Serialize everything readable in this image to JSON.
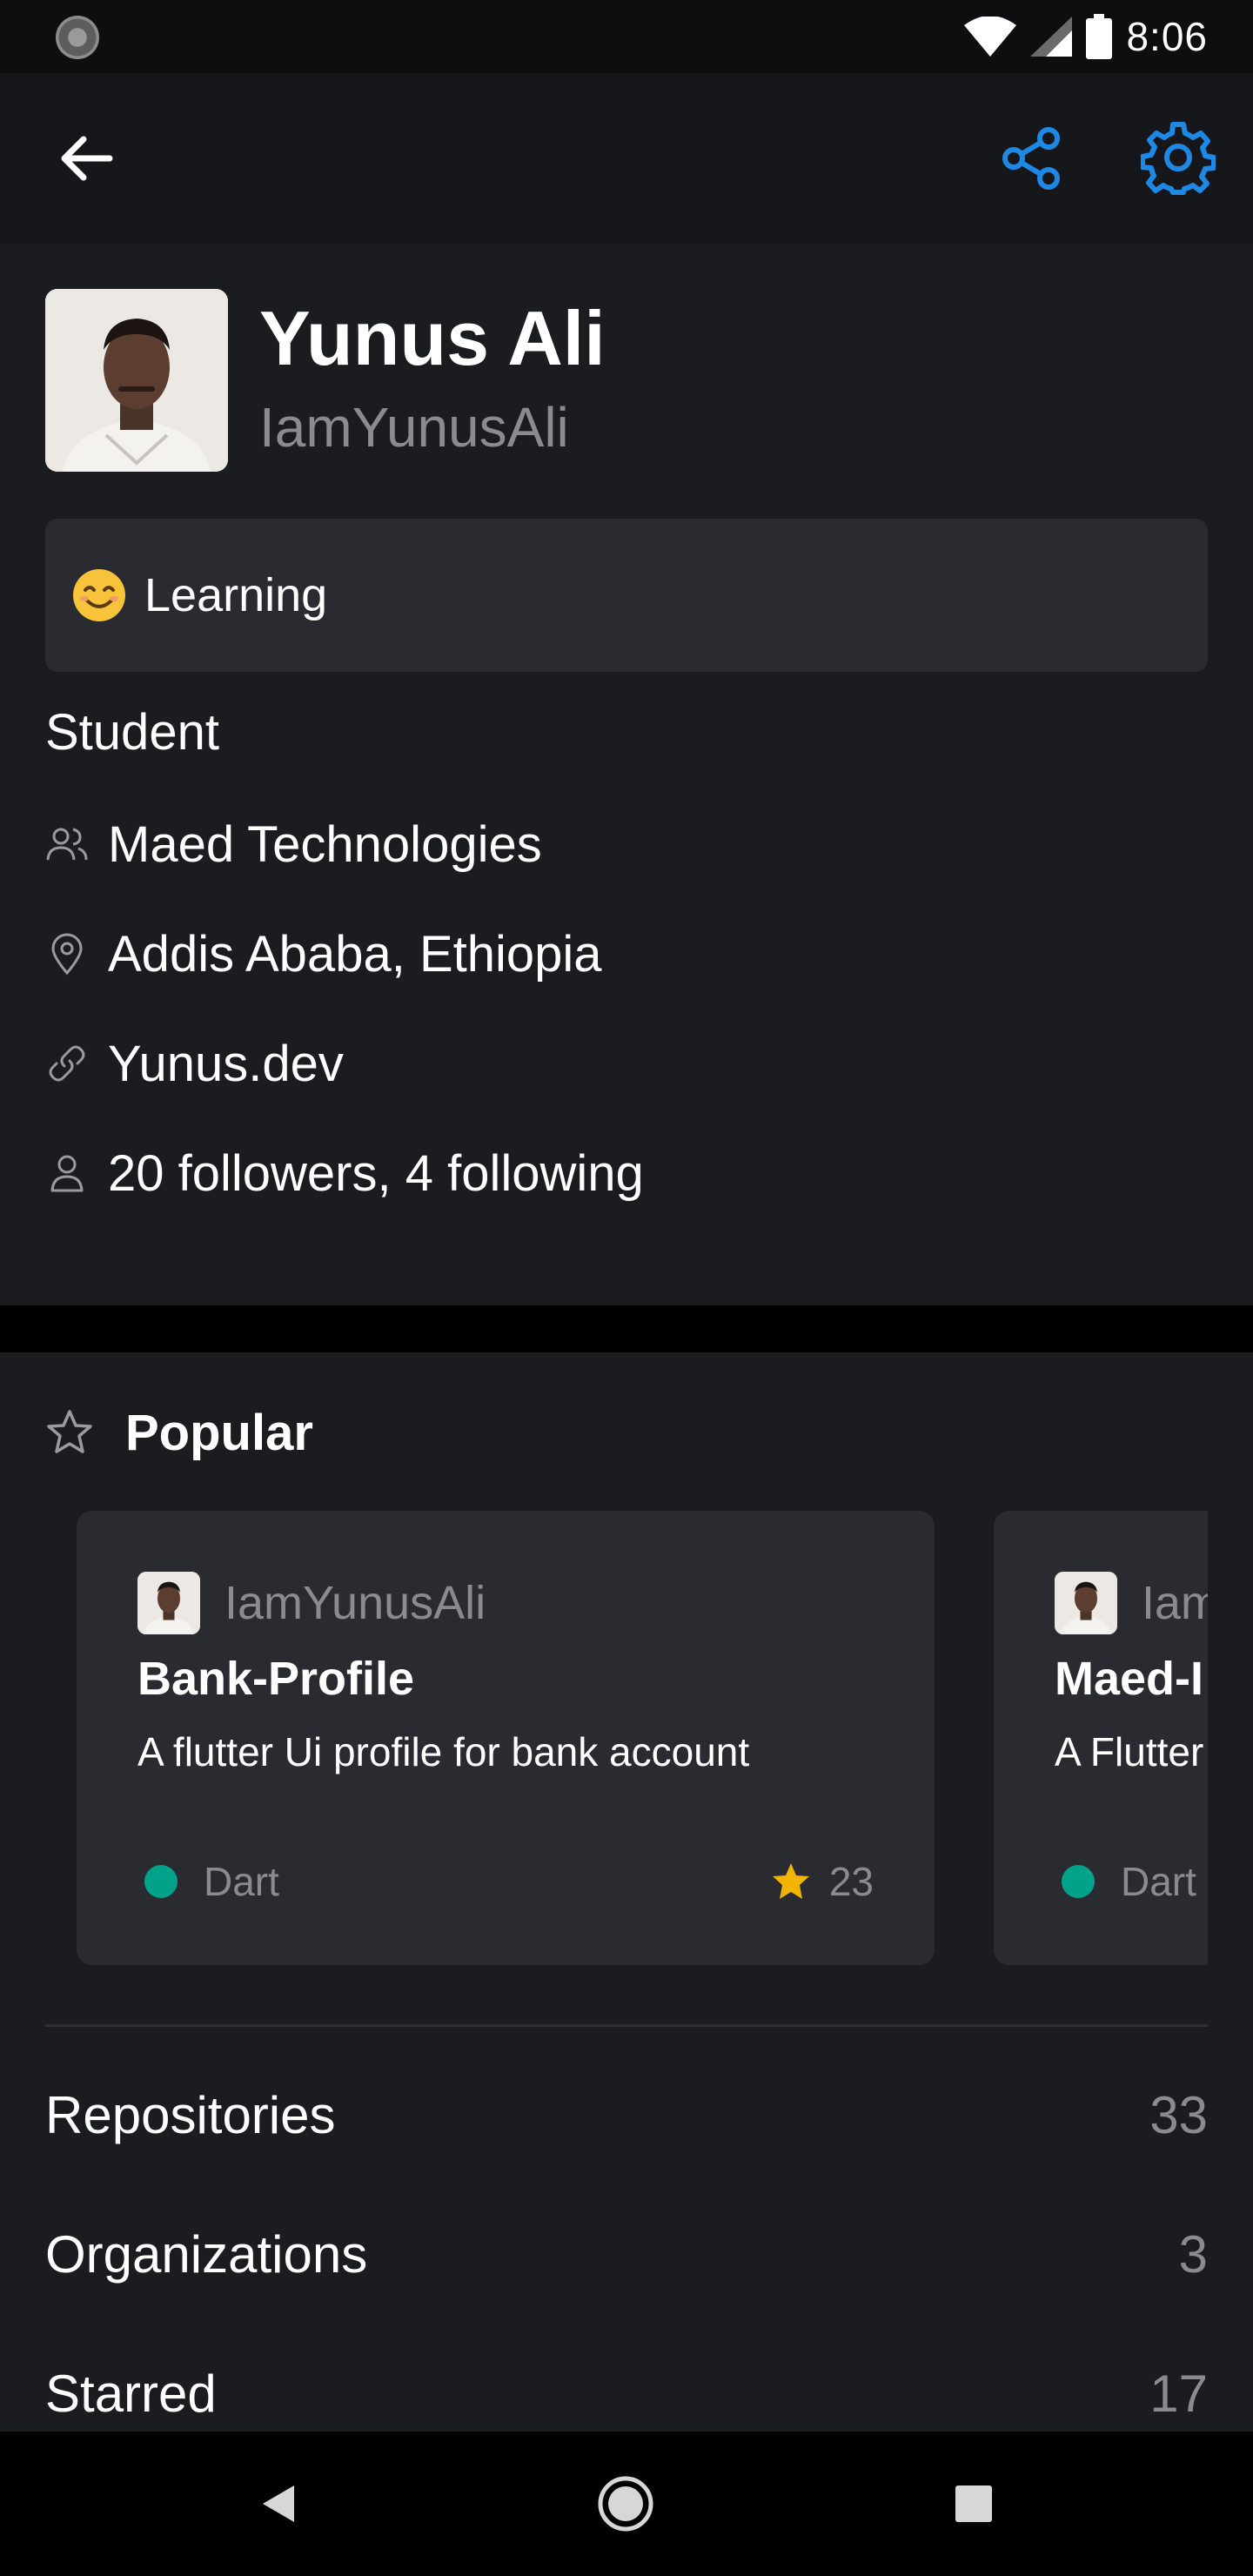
{
  "status_bar": {
    "time": "8:06",
    "icons": [
      "loading-indicator-icon",
      "wifi-icon",
      "cellular-signal-icon",
      "battery-icon"
    ]
  },
  "app_bar": {
    "icons": [
      "back-arrow-icon",
      "share-icon",
      "gear-icon"
    ],
    "accent_color": "#1e88e5"
  },
  "profile": {
    "name": "Yunus Ali",
    "login": "IamYunusAli",
    "status": {
      "emoji": "smiling-face-icon",
      "text": "Learning"
    },
    "bio": "Student",
    "company": "Maed Technologies",
    "location": "Addis Ababa, Ethiopia",
    "website": "Yunus.dev",
    "follow_summary": "20 followers, 4 following"
  },
  "popular": {
    "title": "Popular",
    "repos": [
      {
        "owner": "IamYunusAli",
        "name": "Bank-Profile",
        "description": "A flutter Ui profile for bank account",
        "language": "Dart",
        "language_color": "#00a28a",
        "stars": "23"
      },
      {
        "owner": "IamYunusAli",
        "name": "Maed-I",
        "description": "A Flutter",
        "language": "Dart",
        "language_color": "#00a28a",
        "stars": ""
      }
    ]
  },
  "stats": [
    {
      "label": "Repositories",
      "value": "33"
    },
    {
      "label": "Organizations",
      "value": "3"
    },
    {
      "label": "Starred",
      "value": "17"
    }
  ],
  "nav_bar": {
    "icons": [
      "nav-back-icon",
      "nav-home-icon",
      "nav-recents-icon"
    ]
  }
}
